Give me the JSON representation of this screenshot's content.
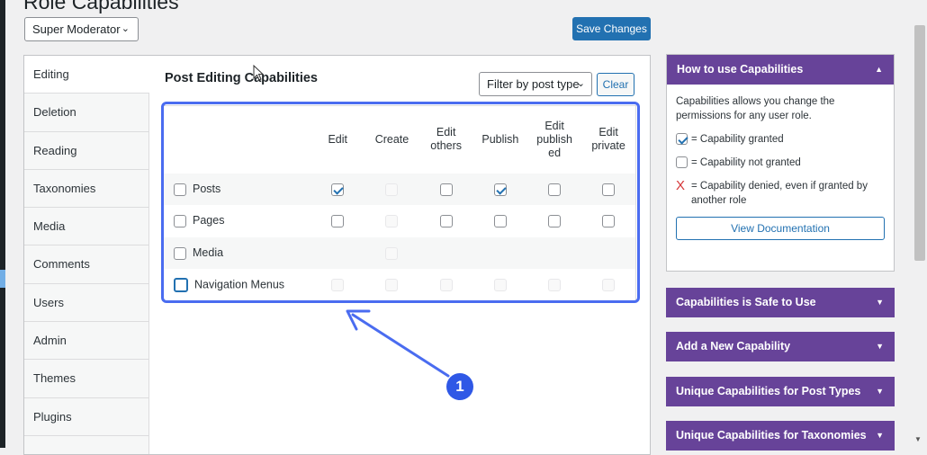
{
  "page": {
    "title": "Role Capabilities"
  },
  "role_selector": {
    "value": "Super Moderator"
  },
  "save_button": {
    "label": "Save Changes"
  },
  "tabs": [
    {
      "label": "Editing",
      "active": true
    },
    {
      "label": "Deletion"
    },
    {
      "label": "Reading"
    },
    {
      "label": "Taxonomies"
    },
    {
      "label": "Media"
    },
    {
      "label": "Comments"
    },
    {
      "label": "Users"
    },
    {
      "label": "Admin"
    },
    {
      "label": "Themes"
    },
    {
      "label": "Plugins"
    }
  ],
  "section": {
    "title": "Post Editing Capabilities",
    "filter": {
      "value": "Filter by post type"
    },
    "clear_label": "Clear"
  },
  "table": {
    "columns": [
      "Edit",
      "Create",
      "Edit others",
      "Publish",
      "Edit publish ed",
      "Edit private"
    ],
    "column_lines": [
      [
        "Edit"
      ],
      [
        "Create"
      ],
      [
        "Edit",
        "others"
      ],
      [
        "Publish"
      ],
      [
        "Edit",
        "publish",
        "ed"
      ],
      [
        "Edit",
        "private"
      ]
    ],
    "rows": [
      {
        "label": "Posts",
        "cells": [
          "checked",
          "disabled",
          "unchecked",
          "checked",
          "unchecked",
          "unchecked"
        ]
      },
      {
        "label": "Pages",
        "cells": [
          "unchecked",
          "disabled",
          "unchecked",
          "unchecked",
          "unchecked",
          "unchecked"
        ]
      },
      {
        "label": "Media",
        "cells": [
          "none",
          "disabled",
          "none",
          "none",
          "none",
          "none"
        ]
      },
      {
        "label": "Navigation Menus",
        "cells": [
          "disabled",
          "disabled",
          "disabled",
          "disabled",
          "disabled",
          "disabled"
        ]
      }
    ]
  },
  "callout": {
    "number": "1"
  },
  "help_panel": {
    "title": "How to use Capabilities",
    "intro": "Capabilities allows you change the permissions for any user role.",
    "legend_granted": "= Capability granted",
    "legend_not_granted": "= Capability not granted",
    "legend_denied_mark": "X",
    "legend_denied": "= Capability denied, even if granted by another role",
    "doc_button": "View Documentation"
  },
  "accordions": [
    {
      "title": "Capabilities is Safe to Use"
    },
    {
      "title": "Add a New Capability"
    },
    {
      "title": "Unique Capabilities for Post Types"
    },
    {
      "title": "Unique Capabilities for Taxonomies"
    }
  ],
  "colors": {
    "accent": "#2271b1",
    "panel_header": "#674399",
    "highlight": "#4a6cf0",
    "denied": "#d63638"
  },
  "icons": {
    "select_chevron": "chevron-down-icon",
    "panel_toggle": "triangle-up-icon",
    "accordion_toggle": "triangle-down-icon"
  }
}
